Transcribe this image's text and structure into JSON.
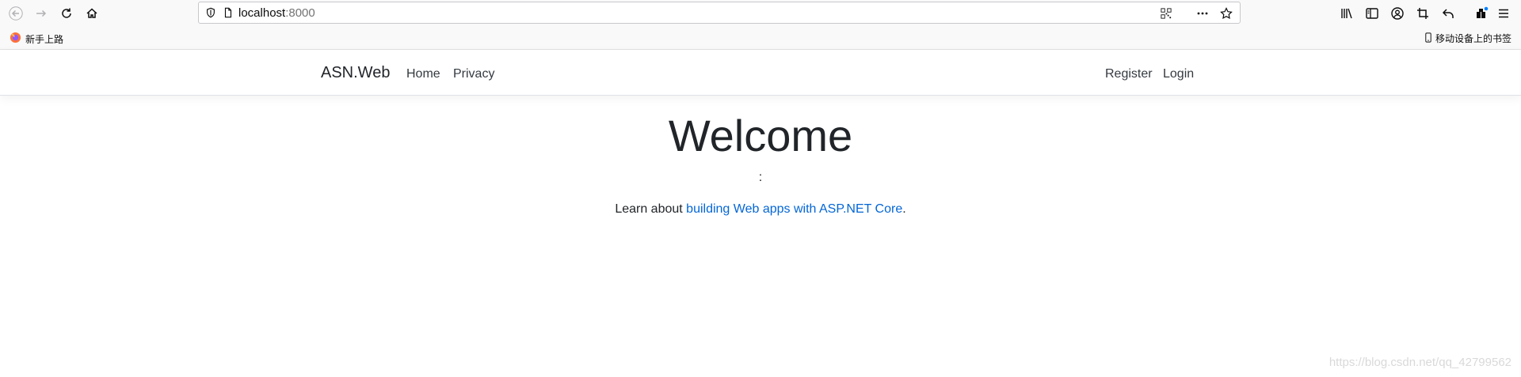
{
  "browser": {
    "url_host": "localhost",
    "url_port": ":8000",
    "icons": {
      "back": "back-arrow-icon",
      "forward": "forward-arrow-icon",
      "reload": "reload-icon",
      "home": "home-icon",
      "shield": "tracking-shield-icon",
      "page": "page-icon",
      "qr": "qr-code-icon",
      "more": "more-actions-icon",
      "bookmark": "bookmark-star-icon",
      "library": "library-icon",
      "sidebar": "sidebar-icon",
      "account": "account-icon",
      "screenshot": "screenshot-icon",
      "undo": "undo-icon",
      "extensions": "extensions-icon",
      "menu": "hamburger-menu-icon"
    },
    "bookmarks": {
      "left_label": "新手上路",
      "right_label": "移动设备上的书签"
    }
  },
  "site": {
    "brand": "ASN.Web",
    "nav_left": [
      "Home",
      "Privacy"
    ],
    "nav_right": [
      "Register",
      "Login"
    ]
  },
  "main": {
    "heading": "Welcome",
    "separator": ":",
    "learn_prefix": "Learn about ",
    "learn_link": "building Web apps with ASP.NET Core",
    "learn_suffix": "."
  },
  "watermark": "https://blog.csdn.net/qq_42799562",
  "colors": {
    "link": "#0366d6",
    "text": "#212529",
    "toolbar_bg": "#f9f9fa"
  }
}
